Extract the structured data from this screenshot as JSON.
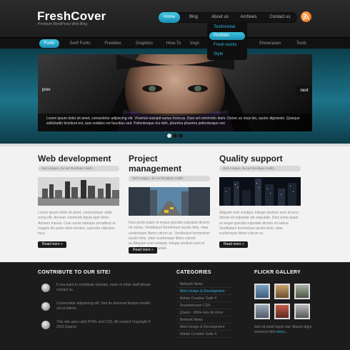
{
  "header": {
    "logo": "FreshCover",
    "tagline": "Premium WordPress Web Blog",
    "nav": [
      {
        "label": "Home",
        "active": true
      },
      {
        "label": "Blog",
        "active": false
      },
      {
        "label": "About us",
        "active": false
      },
      {
        "label": "Archives",
        "active": false
      },
      {
        "label": "Contact us",
        "active": false
      }
    ],
    "rss_icon": "rss-icon",
    "dropdown": [
      {
        "label": "Testimonial",
        "active": false
      },
      {
        "label": "Portfolio",
        "active": true
      },
      {
        "label": "Fresh works",
        "active": false
      },
      {
        "label": "Style",
        "active": false
      }
    ]
  },
  "subnav": [
    {
      "label": "Fonts",
      "active": true
    },
    {
      "label": "Serif Fonts"
    },
    {
      "label": "Freebies"
    },
    {
      "label": "Graphics"
    },
    {
      "label": "How-To"
    },
    {
      "label": "Inspi"
    },
    {
      "label": "Showcases"
    },
    {
      "label": "Tools"
    }
  ],
  "slider": {
    "prev": "prev",
    "next": "next",
    "caption": "Lorem ipsum dolor sit amet, consectetur adipiscing elit. Vivamus suscipit varius rhoncus. Duis vel commodo diam. Donec ac risus leo, auctor dignissim. Quisque sollicitudin tincidunt est, quis sodales est faucibus sed. Pellentesque dui nibh, pharetra pharetra pellentesque nec",
    "dots": 3,
    "active_dot": 0
  },
  "columns": [
    {
      "title": "Web development",
      "meta": "Sed congue, dui vel tincidupe mollis...",
      "text": "Lorem ipsum dolor sit amet, consectetuer adipi scing elit. Aenean commodo ligula eget dolor. Aenean massa. Cum sociis natoque penatibus et magnis dis partu rient montes, nascetur ridiculus mus.",
      "read_more": "Read more"
    },
    {
      "title": "Project management",
      "meta": "Sed congue, dui vel tincidupe mollis...",
      "text": "Duis porta quam et neque gravida vulputate dictum mi varius. Vestibulum fermentum iaculis felis, vitae scelerisque libero rutrum ac. Vestibulum fermentum iaculis felis, vitae scelerisque libero rutrum ac.Aliquam erat volutpat. Integer pretium sem id arcu dictum id vulputate.",
      "read_more": "Read more"
    },
    {
      "title": "Quality support",
      "meta": "Sed congue, dui vel tincidupe mollis...",
      "text": "Aliquam erat volutpat. Integer pretium sem id arcu dictum id vulputate elit vulputate. Duis porta quam et neque gravida vulputate dictum mi varius. Vestibulum fermentum iaculis felis, vitae scelerisque libero rutrum ac.",
      "read_more": "Read more"
    }
  ],
  "footer": {
    "contribute": {
      "title": "CONTRIBUTE TO OUR SITE!",
      "items": [
        {
          "text": "If you want to contribute tutorials, news or other stuff please contact us."
        },
        {
          "text": "Consectetur adipisicing elit. Sed do eiusmod tempor incidid unt ut labore."
        },
        {
          "text": "This site uses valid HTML and CSS. All content Copyright © 2010 Exprox"
        }
      ]
    },
    "categories": {
      "title": "CATEGORIES",
      "items": [
        {
          "label": "Network News",
          "active": false
        },
        {
          "label": "Web Design & Development",
          "active": true
        },
        {
          "label": "Adobe Creative Suite 4",
          "active": false
        },
        {
          "label": "Dreamweaver CS4",
          "active": false
        },
        {
          "label": "jQuery - Write less do more",
          "active": false
        },
        {
          "label": "Network News",
          "active": false
        },
        {
          "label": "Web Design & Development",
          "active": false
        },
        {
          "label": "Adobe Creative Suite 4",
          "active": false
        }
      ]
    },
    "flickr": {
      "title": "FLICKR GALLERY",
      "caption": "Sed sit amet turpis nisl. Mauris digm euismod nibh",
      "more": "more..."
    }
  }
}
